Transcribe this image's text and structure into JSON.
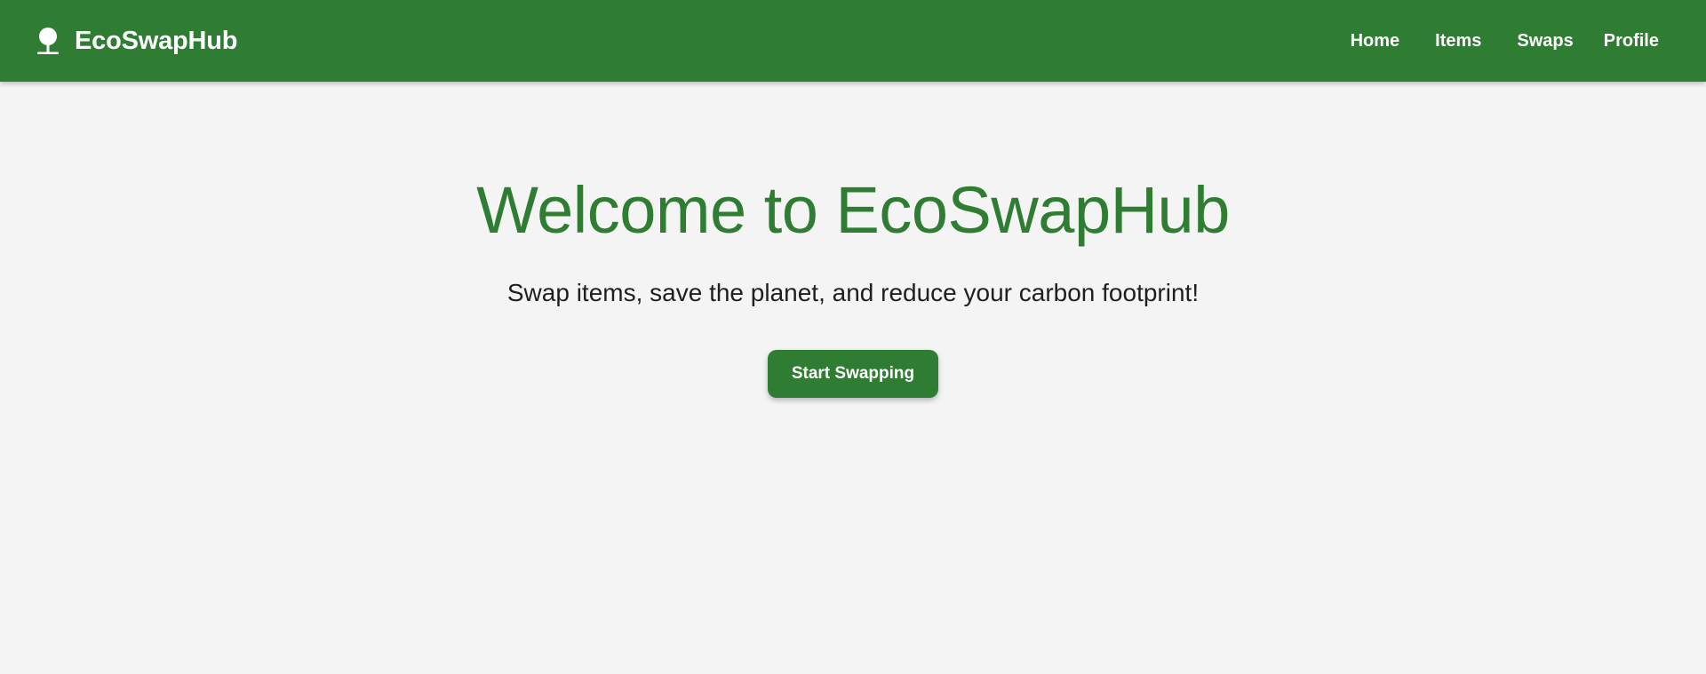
{
  "app": {
    "brand_name": "EcoSwapHub",
    "brand_icon": "tree-icon"
  },
  "nav": {
    "items": [
      {
        "label": "Home"
      },
      {
        "label": "Items"
      },
      {
        "label": "Swaps"
      },
      {
        "label": "Profile"
      }
    ]
  },
  "hero": {
    "title": "Welcome to EcoSwapHub",
    "subtitle": "Swap items, save the planet, and reduce your carbon footprint!",
    "cta_label": "Start Swapping"
  },
  "colors": {
    "primary": "#2e7d32",
    "background": "#f4f4f4",
    "text": "#1f1f1f",
    "on_primary": "#ffffff"
  }
}
